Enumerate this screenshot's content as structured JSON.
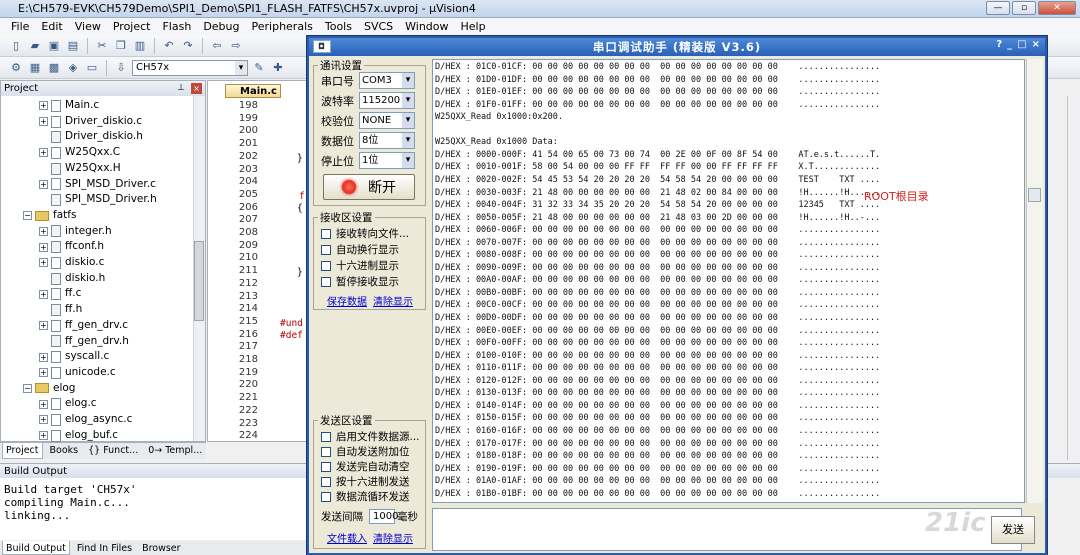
{
  "ide": {
    "title": "E:\\CH579-EVK\\CH579Demo\\SPI1_Demo\\SPI1_FLASH_FATFS\\CH57x.uvproj - µVision4",
    "window_buttons": [
      "—",
      "▫",
      "✕"
    ],
    "menu": [
      "File",
      "Edit",
      "View",
      "Project",
      "Flash",
      "Debug",
      "Peripherals",
      "Tools",
      "SVCS",
      "Window",
      "Help"
    ],
    "target": "CH57x",
    "project_panel_title": "Project",
    "tree": [
      {
        "label": "Main.c",
        "type": "file",
        "expand": "+"
      },
      {
        "label": "Driver_diskio.c",
        "type": "file",
        "expand": "+"
      },
      {
        "label": "Driver_diskio.h",
        "type": "header",
        "expand": ""
      },
      {
        "label": "W25Qxx.C",
        "type": "file",
        "expand": "+"
      },
      {
        "label": "W25Qxx.H",
        "type": "header",
        "expand": ""
      },
      {
        "label": "SPI_MSD_Driver.c",
        "type": "file",
        "expand": "+"
      },
      {
        "label": "SPI_MSD_Driver.h",
        "type": "header",
        "expand": ""
      },
      {
        "label": "fatfs",
        "type": "folder",
        "expand": "−"
      },
      {
        "label": "integer.h",
        "type": "header",
        "expand": "+"
      },
      {
        "label": "ffconf.h",
        "type": "header",
        "expand": "+"
      },
      {
        "label": "diskio.c",
        "type": "file",
        "expand": "+"
      },
      {
        "label": "diskio.h",
        "type": "header",
        "expand": ""
      },
      {
        "label": "ff.c",
        "type": "file",
        "expand": "+"
      },
      {
        "label": "ff.h",
        "type": "header",
        "expand": ""
      },
      {
        "label": "ff_gen_drv.c",
        "type": "file",
        "expand": "+"
      },
      {
        "label": "ff_gen_drv.h",
        "type": "header",
        "expand": ""
      },
      {
        "label": "syscall.c",
        "type": "file",
        "expand": "+"
      },
      {
        "label": "unicode.c",
        "type": "file",
        "expand": "+"
      },
      {
        "label": "elog",
        "type": "folder",
        "expand": "−"
      },
      {
        "label": "elog.c",
        "type": "file",
        "expand": "+"
      },
      {
        "label": "elog_async.c",
        "type": "file",
        "expand": "+"
      },
      {
        "label": "elog_buf.c",
        "type": "file",
        "expand": "+"
      }
    ],
    "project_tabs": [
      "Project",
      "Books",
      "{} Funct...",
      "0→ Templ..."
    ],
    "editor_tab": "Main.c",
    "line_numbers": [
      "198",
      "199",
      "200",
      "201",
      "202",
      "203",
      "204",
      "205",
      "206",
      "207",
      "208",
      "209",
      "210",
      "211",
      "212",
      "213",
      "214",
      "215",
      "216",
      "217",
      "218",
      "219",
      "220",
      "221",
      "222",
      "223",
      "224"
    ],
    "code_fragments": {
      "brace1": "}",
      "f": "f",
      "brace2": "{",
      "brace3": "}",
      "undef": "#und",
      "def": "#def"
    },
    "build_title": "Build Output",
    "build_lines": [
      "Build target 'CH57x'",
      "compiling Main.c...",
      "linking..."
    ],
    "build_tabs": [
      "Build Output",
      "Find In Files",
      "Browser"
    ]
  },
  "serial": {
    "title": "串口调试助手 (精装版 V3.6)",
    "title_buttons": [
      "?",
      "_",
      "□",
      "×"
    ],
    "comm_group": "通讯设置",
    "settings": [
      {
        "label": "串口号",
        "value": "COM3"
      },
      {
        "label": "波特率",
        "value": "115200"
      },
      {
        "label": "校验位",
        "value": "NONE"
      },
      {
        "label": "数据位",
        "value": "8位"
      },
      {
        "label": "停止位",
        "value": "1位"
      }
    ],
    "open_button": "断开",
    "recv_group": "接收区设置",
    "recv_options": [
      "接收转向文件...",
      "自动换行显示",
      "十六进制显示",
      "暂停接收显示"
    ],
    "recv_links": [
      "保存数据",
      "清除显示"
    ],
    "send_group": "发送区设置",
    "send_options": [
      "启用文件数据源...",
      "自动发送附加位",
      "发送完自动清空",
      "按十六进制发送",
      "数据流循环发送"
    ],
    "interval_label": "发送间隔",
    "interval_value": "1000",
    "interval_unit": "毫秒",
    "send_links": [
      "文件载入",
      "清除显示"
    ],
    "send_button": "发送",
    "hex_lines": [
      "D/HEX : 01C0-01CF: 00 00 00 00 00 00 00 00  00 00 00 00 00 00 00 00    ................",
      "D/HEX : 01D0-01DF: 00 00 00 00 00 00 00 00  00 00 00 00 00 00 00 00    ................",
      "D/HEX : 01E0-01EF: 00 00 00 00 00 00 00 00  00 00 00 00 00 00 00 00    ................",
      "D/HEX : 01F0-01FF: 00 00 00 00 00 00 00 00  00 00 00 00 00 00 00 00    ................",
      "W25QXX_Read 0x1000:0x200.",
      "",
      "W25QXX_Read 0x1000 Data:",
      "D/HEX : 0000-000F: 41 54 00 65 00 73 00 74  00 2E 00 0F 00 8F 54 00    AT.e.s.t......T.",
      "D/HEX : 0010-001F: 58 00 54 00 00 00 FF FF  FF FF 00 00 FF FF FF FF    X.T.............",
      "D/HEX : 0020-002F: 54 45 53 54 20 20 20 20  54 58 54 20 00 00 00 00    TEST    TXT ....",
      "D/HEX : 0030-003F: 21 48 00 00 00 00 00 00  21 48 02 00 84 00 00 00    !H......!H......",
      "D/HEX : 0040-004F: 31 32 33 34 35 20 20 20  54 58 54 20 00 00 00 00    12345   TXT ....",
      "D/HEX : 0050-005F: 21 48 00 00 00 00 00 00  21 48 03 00 2D 00 00 00    !H......!H..-...",
      "D/HEX : 0060-006F: 00 00 00 00 00 00 00 00  00 00 00 00 00 00 00 00    ................",
      "D/HEX : 0070-007F: 00 00 00 00 00 00 00 00  00 00 00 00 00 00 00 00    ................",
      "D/HEX : 0080-008F: 00 00 00 00 00 00 00 00  00 00 00 00 00 00 00 00    ................",
      "D/HEX : 0090-009F: 00 00 00 00 00 00 00 00  00 00 00 00 00 00 00 00    ................",
      "D/HEX : 00A0-00AF: 00 00 00 00 00 00 00 00  00 00 00 00 00 00 00 00    ................",
      "D/HEX : 00B0-00BF: 00 00 00 00 00 00 00 00  00 00 00 00 00 00 00 00    ................",
      "D/HEX : 00C0-00CF: 00 00 00 00 00 00 00 00  00 00 00 00 00 00 00 00    ................",
      "D/HEX : 00D0-00DF: 00 00 00 00 00 00 00 00  00 00 00 00 00 00 00 00    ................",
      "D/HEX : 00E0-00EF: 00 00 00 00 00 00 00 00  00 00 00 00 00 00 00 00    ................",
      "D/HEX : 00F0-00FF: 00 00 00 00 00 00 00 00  00 00 00 00 00 00 00 00    ................",
      "D/HEX : 0100-010F: 00 00 00 00 00 00 00 00  00 00 00 00 00 00 00 00    ................",
      "D/HEX : 0110-011F: 00 00 00 00 00 00 00 00  00 00 00 00 00 00 00 00    ................",
      "D/HEX : 0120-012F: 00 00 00 00 00 00 00 00  00 00 00 00 00 00 00 00    ................",
      "D/HEX : 0130-013F: 00 00 00 00 00 00 00 00  00 00 00 00 00 00 00 00    ................",
      "D/HEX : 0140-014F: 00 00 00 00 00 00 00 00  00 00 00 00 00 00 00 00    ................",
      "D/HEX : 0150-015F: 00 00 00 00 00 00 00 00  00 00 00 00 00 00 00 00    ................",
      "D/HEX : 0160-016F: 00 00 00 00 00 00 00 00  00 00 00 00 00 00 00 00    ................",
      "D/HEX : 0170-017F: 00 00 00 00 00 00 00 00  00 00 00 00 00 00 00 00    ................",
      "D/HEX : 0180-018F: 00 00 00 00 00 00 00 00  00 00 00 00 00 00 00 00    ................",
      "D/HEX : 0190-019F: 00 00 00 00 00 00 00 00  00 00 00 00 00 00 00 00    ................",
      "D/HEX : 01A0-01AF: 00 00 00 00 00 00 00 00  00 00 00 00 00 00 00 00    ................",
      "D/HEX : 01B0-01BF: 00 00 00 00 00 00 00 00  00 00 00 00 00 00 00 00    ................"
    ],
    "root_note": "ROOT根目录"
  },
  "watermark": "21ic"
}
